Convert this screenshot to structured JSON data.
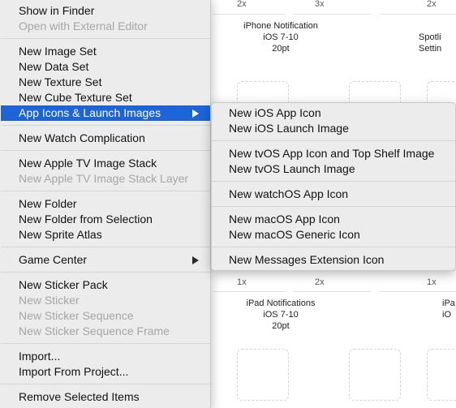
{
  "background": {
    "scale_labels_top": [
      "2x",
      "3x",
      "2x"
    ],
    "scale_labels_bottom": [
      "1x",
      "2x",
      "1x"
    ],
    "captions_top": [
      {
        "lines": [
          "iPhone Notification",
          "iOS 7-10",
          "20pt"
        ]
      },
      {
        "lines": [
          "Spotli",
          "Settin"
        ]
      }
    ],
    "captions_bottom": [
      {
        "lines": [
          "iPad Notifications",
          "iOS 7-10",
          "20pt"
        ]
      },
      {
        "lines": [
          "iPa",
          "iO"
        ]
      }
    ]
  },
  "menu": {
    "items": [
      {
        "label": "Show in Finder",
        "disabled": false
      },
      {
        "label": "Open with External Editor",
        "disabled": true
      },
      {
        "label": "New Image Set",
        "disabled": false
      },
      {
        "label": "New Data Set",
        "disabled": false
      },
      {
        "label": "New Texture Set",
        "disabled": false
      },
      {
        "label": "New Cube Texture Set",
        "disabled": false
      },
      {
        "label": "App Icons & Launch Images",
        "disabled": false,
        "selected": true,
        "submenu": true
      },
      {
        "label": "New Watch Complication",
        "disabled": false
      },
      {
        "label": "New Apple TV Image Stack",
        "disabled": false
      },
      {
        "label": "New Apple TV Image Stack Layer",
        "disabled": true
      },
      {
        "label": "New Folder",
        "disabled": false
      },
      {
        "label": "New Folder from Selection",
        "disabled": false
      },
      {
        "label": "New Sprite Atlas",
        "disabled": false
      },
      {
        "label": "Game Center",
        "disabled": false,
        "submenu": true
      },
      {
        "label": "New Sticker Pack",
        "disabled": false
      },
      {
        "label": "New Sticker",
        "disabled": true
      },
      {
        "label": "New Sticker Sequence",
        "disabled": true
      },
      {
        "label": "New Sticker Sequence Frame",
        "disabled": true
      },
      {
        "label": "Import...",
        "disabled": false
      },
      {
        "label": "Import From Project...",
        "disabled": false
      },
      {
        "label": "Remove Selected Items",
        "disabled": false
      }
    ]
  },
  "submenu": {
    "items": [
      {
        "label": "New iOS App Icon"
      },
      {
        "label": "New iOS Launch Image"
      },
      {
        "label": "New tvOS App Icon and Top Shelf Image"
      },
      {
        "label": "New tvOS Launch Image"
      },
      {
        "label": "New watchOS App Icon"
      },
      {
        "label": "New macOS App Icon"
      },
      {
        "label": "New macOS Generic Icon"
      },
      {
        "label": "New Messages Extension Icon"
      }
    ]
  },
  "colors": {
    "menu_bg": "#ececec",
    "selection": "#1c64d8",
    "disabled_text": "#a6a6a6"
  }
}
